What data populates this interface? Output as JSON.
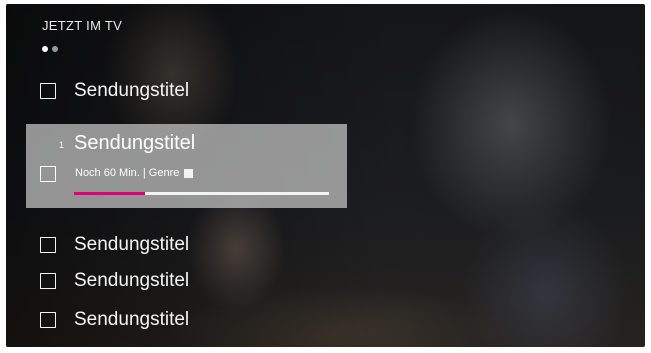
{
  "header": {
    "title": "JETZT IM TV"
  },
  "pagination": {
    "total": 2,
    "active": 1
  },
  "list": {
    "items": [
      {
        "title": "Sendungstitel"
      },
      {
        "title": "Sendungstitel",
        "number": "1",
        "meta": "Noch 60 Min. | Genre",
        "progress": 0.28,
        "selected": true
      },
      {
        "title": "Sendungstitel"
      },
      {
        "title": "Sendungstitel"
      },
      {
        "title": "Sendungstitel"
      }
    ]
  },
  "colors": {
    "accent": "#e20074",
    "highlight": "#c8c8c8",
    "text": "#ffffff"
  }
}
